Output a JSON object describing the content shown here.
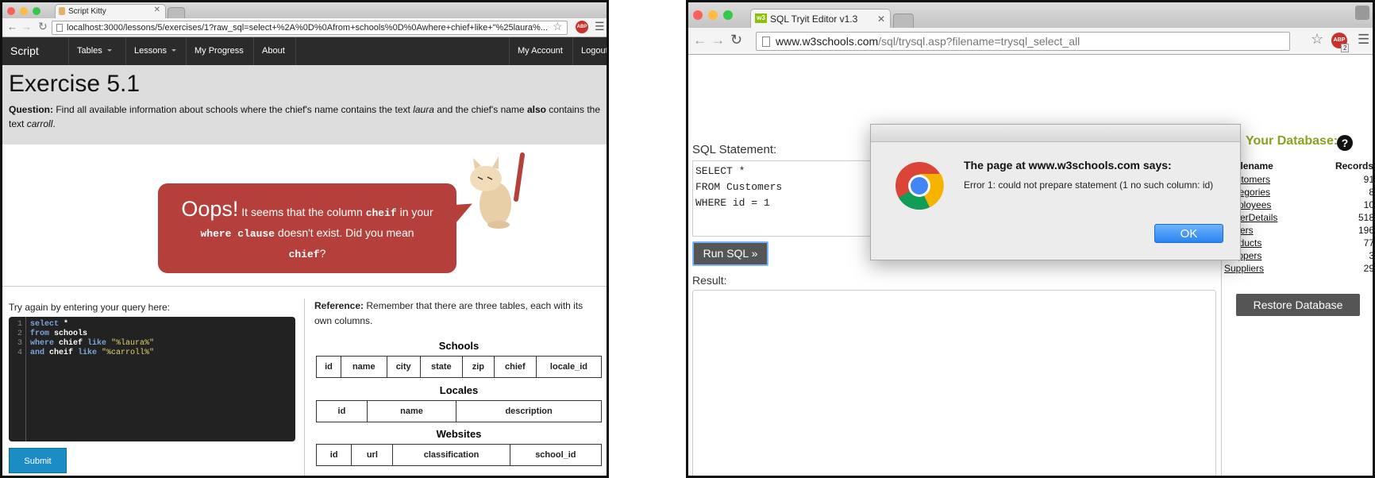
{
  "left": {
    "tab_title": "Script Kitty",
    "url": "localhost:3000/lessons/5/exercises/1?raw_sql=select+%2A%0D%0Afrom+schools%0D%0Awhere+chief+like+\"%25laura%...",
    "abp": "ABP",
    "nav": {
      "brand": "Script Kitty",
      "tables": "Tables",
      "lessons": "Lessons",
      "progress": "My Progress",
      "about": "About",
      "account": "My Account",
      "logout": "Logout"
    },
    "title": "Exercise 5.1",
    "question": {
      "label": "Question:",
      "p1": " Find all available information about schools where the chief's name contains the text ",
      "laura": "laura",
      "p2": " and the chief's name ",
      "also": "also",
      "p3": " contains the text ",
      "carroll": "carroll",
      "p4": "."
    },
    "error": {
      "oops": "Oops!",
      "t1": " It seems that the column ",
      "c1": "cheif",
      "t2": " in your",
      "c2": "where clause",
      "t3": " doesn't exist. Did you mean",
      "c3": "chief",
      "t4": "?"
    },
    "try_label": "Try again by entering your query here:",
    "code_lines": [
      {
        "n": "1",
        "a": "select",
        "b": " *",
        "c": ""
      },
      {
        "n": "2",
        "a": "from",
        "b": " schools",
        "c": ""
      },
      {
        "n": "3",
        "a": "where",
        "b": " chief ",
        "k": "like",
        "c": " \"%laura%\""
      },
      {
        "n": "4",
        "a": "and",
        "b": " cheif ",
        "k": "like",
        "c": " \"%carroll%\""
      }
    ],
    "submit": "Submit",
    "reference": {
      "label": "Reference:",
      "text": " Remember that there are three tables, each with its own columns."
    },
    "tables": [
      {
        "name": "Schools",
        "cols": [
          "id",
          "name",
          "city",
          "state",
          "zip",
          "chief",
          "locale_id"
        ]
      },
      {
        "name": "Locales",
        "cols": [
          "id",
          "name",
          "description"
        ]
      },
      {
        "name": "Websites",
        "cols": [
          "id",
          "url",
          "classification",
          "school_id"
        ]
      }
    ]
  },
  "right": {
    "tab_title": "SQL Tryit Editor v1.3",
    "tab_icon_text": "w3",
    "url_host": "www.w3schools.com",
    "url_path": "/sql/trysql.asp?filename=trysql_select_all",
    "abp": "ABP",
    "abp_count": "2",
    "sql_label": "SQL Statement:",
    "sql_text": "SELECT *\nFROM Customers\nWHERE id = 1",
    "run_button": "Run SQL »",
    "result_label": "Result:",
    "your_db": "Your Database:",
    "help": "?",
    "db_headers": {
      "name": "Tablename",
      "records": "Records"
    },
    "db_rows": [
      {
        "name": "Customers",
        "count": "91"
      },
      {
        "name": "Categories",
        "count": "8"
      },
      {
        "name": "Employees",
        "count": "10"
      },
      {
        "name": "OrderDetails",
        "count": "518"
      },
      {
        "name": "Orders",
        "count": "196"
      },
      {
        "name": "Products",
        "count": "77"
      },
      {
        "name": "Shippers",
        "count": "3"
      },
      {
        "name": "Suppliers",
        "count": "29"
      }
    ],
    "restore": "Restore Database",
    "dialog": {
      "heading": "The page at www.w3schools.com says:",
      "message": "Error 1: could not prepare statement (1 no such column: id)",
      "ok": "OK"
    }
  }
}
